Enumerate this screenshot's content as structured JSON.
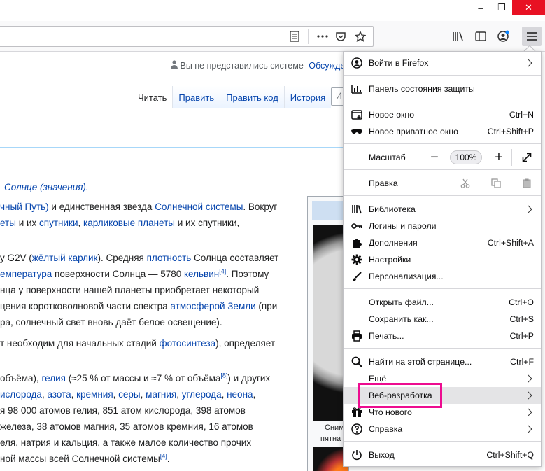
{
  "window": {
    "minimize": "–",
    "restore": "❐",
    "close": "✕"
  },
  "toolbar": {
    "icons": [
      "reader-view-icon",
      "more-icon",
      "pocket-icon",
      "bookmark-star-icon",
      "library-icon",
      "sidebar-icon",
      "account-icon",
      "menu-icon"
    ]
  },
  "wiki": {
    "personal": {
      "not_logged_in": "Вы не представились системе",
      "discussion": "Обсужде"
    },
    "tabs": [
      "Читать",
      "Править",
      "Править код",
      "История"
    ],
    "search_placeholder": "И",
    "hatnote": "Солнце (значения).",
    "para1": {
      "l1": {
        "a": "чный Путь)",
        "b": " и единственная звезда ",
        "c": "Солнечной системы",
        "d": ". Вокруг"
      },
      "l2": {
        "a": "еты",
        "b": " и их ",
        "c": "спутники",
        "d": ", ",
        "e": "карликовые планеты",
        "f": " и их спутники,"
      }
    },
    "para2": {
      "l1": {
        "a": "y G2V (",
        "b": "жёлтый карлик",
        "c": "). Средняя ",
        "d": "плотность",
        "e": " Солнца составляет"
      },
      "l2": {
        "a": "емпература",
        "b": " поверхности Солнца — 5780 ",
        "c": "кельвин",
        "sup": "[4]",
        "d": ". Поэтому"
      },
      "l3": "нца у поверхности нашей планеты приобретает некоторый",
      "l4": {
        "a": "цения коротковолновой части спектра ",
        "b": "атмосферой Земли",
        "c": " (при"
      },
      "l5": "ра, солнечный свет вновь даёт белое освещение)."
    },
    "para3": {
      "a": "т необходим для начальных стадий ",
      "b": "фотосинтеза",
      "c": "), определяет"
    },
    "para4": {
      "l1": {
        "a": "объёма), ",
        "b": "гелия",
        "c": " (≈25 % от массы и ≈7 % от объёма",
        "sup": "[8]",
        "d": ") и других"
      },
      "l2": {
        "a": "ислорода",
        "b": ", ",
        "c": "азота",
        "d": ", ",
        "e": "кремния",
        "f": ", ",
        "g": "серы",
        "h": ", ",
        "i": "магния",
        "j": ", ",
        "k": "углерода",
        "l": ", ",
        "m": "неона",
        "n": ","
      },
      "l3": "я 98 000 атомов гелия, 851 атом кислорода, 398 атомов",
      "l4": "железа, 38 атомов магния, 35 атомов кремния, 16 атомов",
      "l5": "еля, натрия и кальция, а также малое количество прочих",
      "l6": {
        "a": "ной массы всей Солнечной системы",
        "sup": "[4]",
        "b": "."
      }
    },
    "infobox_caption": {
      "l1": "Сним",
      "l2": "пятна"
    }
  },
  "menu": {
    "sign_in": "Войти в Firefox",
    "protections": "Панель состояния защиты",
    "new_window": {
      "label": "Новое окно",
      "shortcut": "Ctrl+N"
    },
    "new_private": {
      "label": "Новое приватное окно",
      "shortcut": "Ctrl+Shift+P"
    },
    "zoom": {
      "label": "Масштаб",
      "minus": "−",
      "value": "100%",
      "plus": "+"
    },
    "edit": {
      "label": "Правка"
    },
    "library": "Библиотека",
    "logins": "Логины и пароли",
    "addons": {
      "label": "Дополнения",
      "shortcut": "Ctrl+Shift+A"
    },
    "settings": "Настройки",
    "customize": "Персонализация...",
    "open_file": {
      "label": "Открыть файл...",
      "shortcut": "Ctrl+O"
    },
    "save_as": {
      "label": "Сохранить как...",
      "shortcut": "Ctrl+S"
    },
    "print": {
      "label": "Печать...",
      "shortcut": "Ctrl+P"
    },
    "find": {
      "label": "Найти на этой странице...",
      "shortcut": "Ctrl+F"
    },
    "more": "Ещё",
    "web_dev": "Веб-разработка",
    "whats_new": "Что нового",
    "help": "Справка",
    "exit": {
      "label": "Выход",
      "shortcut": "Ctrl+Shift+Q"
    }
  },
  "colors": {
    "highlight": "#ed0c90",
    "link": "#0645ad",
    "close": "#e81123"
  }
}
